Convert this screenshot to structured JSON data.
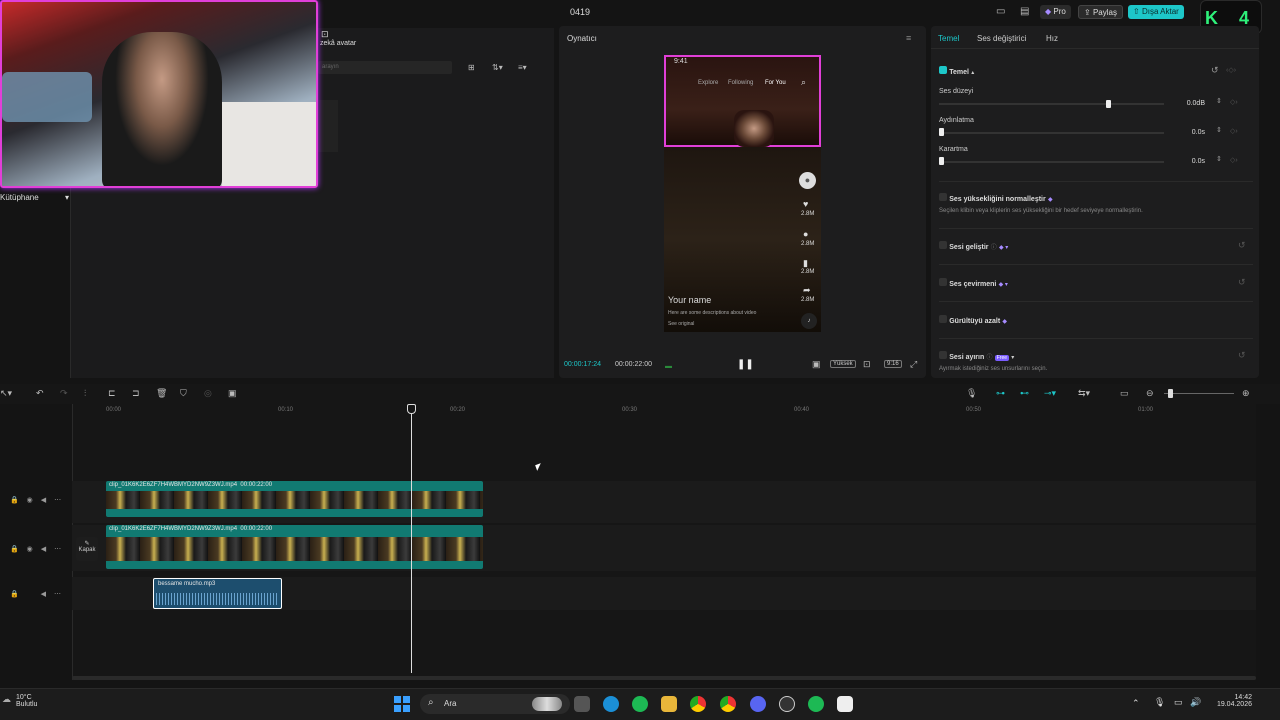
{
  "window": {
    "title": "0419"
  },
  "header": {
    "pro_label": "Pro",
    "share_label": "Paylaş",
    "export_label": "Dışa Aktar",
    "logo_text": "K 4"
  },
  "library": {
    "avatar_label": "zekâ avatar",
    "search_placeholder": "arayın",
    "sidebar_label": "Kütüphane"
  },
  "player": {
    "title": "Oynatıcı",
    "current_time": "00:00:17:24",
    "total_time": "00:00:22:00",
    "quality_label": "Yüksek",
    "ratio_label": "9:16",
    "phone": {
      "clock": "9:41",
      "tabs": [
        "Explore",
        "Following",
        "For You"
      ],
      "username": "Your name",
      "description": "Here are some descriptions about video",
      "sound": "See original",
      "like_count": "2.8M",
      "comment_count": "2.8M",
      "save_count": "2.8M",
      "share_count": "2.8M"
    }
  },
  "inspector": {
    "tabs": [
      "Temel",
      "Ses değiştirici",
      "Hız"
    ],
    "section_title": "Temel",
    "volume_label": "Ses düzeyi",
    "volume_value": "0.0dB",
    "volume_level": 0.74,
    "fadein_label": "Aydınlatma",
    "fadein_value": "0.0s",
    "fadeout_label": "Karartma",
    "fadeout_value": "0.0s",
    "normalize_label": "Ses yüksekliğini normalleştir",
    "normalize_desc": "Seçilen klibin veya kliplerin ses yüksekliğini bir hedef seviyeye normalleştirin.",
    "enhance_label": "Sesi geliştir",
    "translate_label": "Ses çevirmeni",
    "denoise_label": "Gürültüyü azalt",
    "separate_label": "Sesi ayırın",
    "separate_badge": "Free",
    "separate_desc": "Ayırmak istediğiniz ses unsurlarını seçin."
  },
  "timeline": {
    "ruler": [
      "00:00",
      "00:10",
      "00:20",
      "00:30",
      "00:40",
      "00:50",
      "01:00"
    ],
    "cover_label": "Kapak",
    "clips": [
      {
        "name": "clip_01K6K2E6ZF7H4WBMYD2NW9Z3WJ.mp4",
        "duration": "00:00:22:00"
      },
      {
        "name": "clip_01K6K2E6ZF7H4WBMYD2NW9Z3WJ.mp4",
        "duration": "00:00:22:00"
      }
    ],
    "audio": {
      "name": "bessame mucho.mp3"
    }
  },
  "taskbar": {
    "weather_temp": "10°C",
    "weather_desc": "Bulutlu",
    "search_label": "Ara",
    "time": "14:42",
    "date": "19.04.2026"
  },
  "colors": {
    "accent": "#1dc7c9",
    "track": "#117a72",
    "audio": "#1d4e6e",
    "webcam_border": "#e13fd8"
  }
}
